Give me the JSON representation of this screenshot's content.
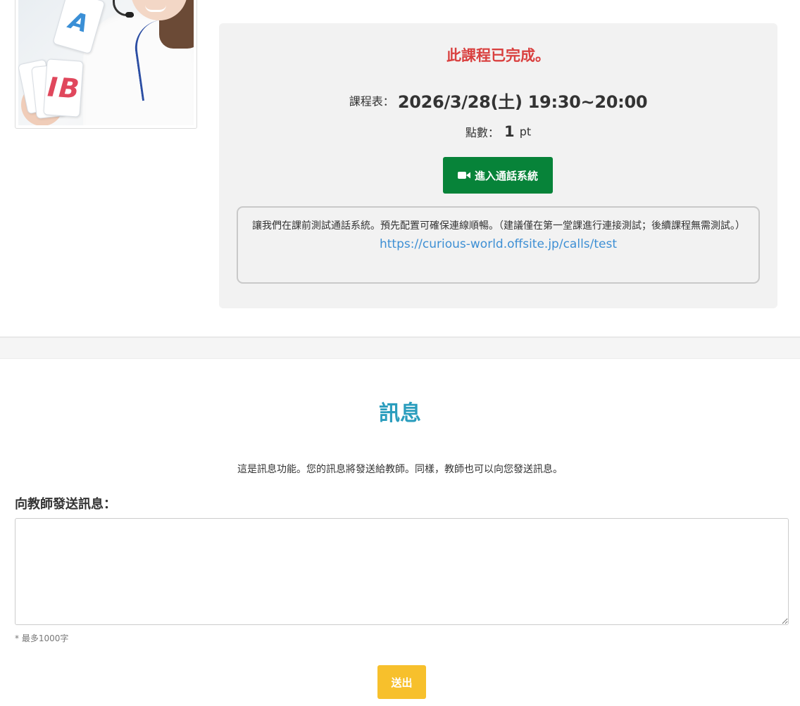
{
  "lesson": {
    "status": "此課程已完成。",
    "schedule_label": "課程表：",
    "schedule_value": "2026/3/28(土) 19:30~20:00",
    "points_label": "點數：",
    "points_value": "1",
    "points_unit": "pt",
    "call_button_label": "進入通話系統",
    "call_button_icon": "video-camera-icon",
    "test_note": "讓我們在課前測試通話系統。預先配置可確保連線順暢。（建議僅在第一堂課進行連接測試；後續課程無需測試。）",
    "test_link": "https://curious-world.offsite.jp/calls/test"
  },
  "photo": {
    "card_a": "A",
    "card_b": "B",
    "card_b_prefix": "I"
  },
  "messages": {
    "title": "訊息",
    "description": "這是訊息功能。您的訊息將發送給教師。同樣，教師也可以向您發送訊息。",
    "label": "向教師發送訊息：",
    "textarea_value": "",
    "char_limit": "* 最多1000字",
    "send_button_label": "送出"
  },
  "colors": {
    "status_red": "#d9403f",
    "call_green": "#078339",
    "link_blue": "#3d8fd4",
    "title_teal": "#2a9dbd",
    "send_yellow": "#f7c02c",
    "panel_gray": "#f2f2f2"
  }
}
